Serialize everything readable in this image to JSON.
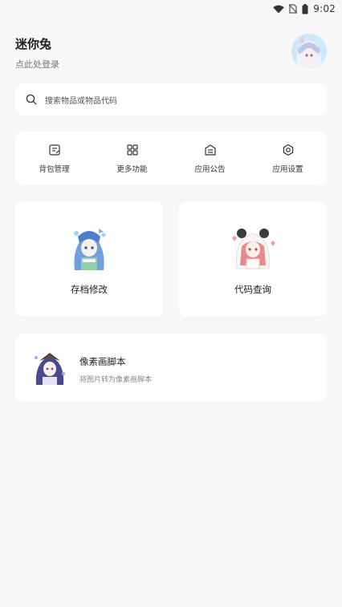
{
  "status_bar": {
    "time": "9:02",
    "icons": [
      "wifi-icon",
      "no-sim-icon",
      "battery-icon"
    ]
  },
  "profile": {
    "name": "迷你兔",
    "login_prompt": "点此处登录"
  },
  "search": {
    "placeholder": "搜索物品或物品代码"
  },
  "quick_actions": [
    {
      "label": "背包管理",
      "icon": "backpack-manage-icon"
    },
    {
      "label": "更多功能",
      "icon": "more-functions-grid-icon"
    },
    {
      "label": "应用公告",
      "icon": "announcement-icon"
    },
    {
      "label": "应用设置",
      "icon": "settings-gear-icon"
    }
  ],
  "features": [
    {
      "label": "存档修改",
      "icon": "anime-girl-blue-hair-illustration"
    },
    {
      "label": "代码查询",
      "icon": "anime-girl-panda-hood-illustration"
    }
  ],
  "script_card": {
    "title": "像素画脚本",
    "subtitle": "将图片转为像素画脚本",
    "icon": "anime-girl-purple-hair-illustration"
  },
  "colors": {
    "background": "#f7f7f8",
    "card": "#ffffff",
    "text_primary": "#222222",
    "text_secondary": "#888888"
  }
}
